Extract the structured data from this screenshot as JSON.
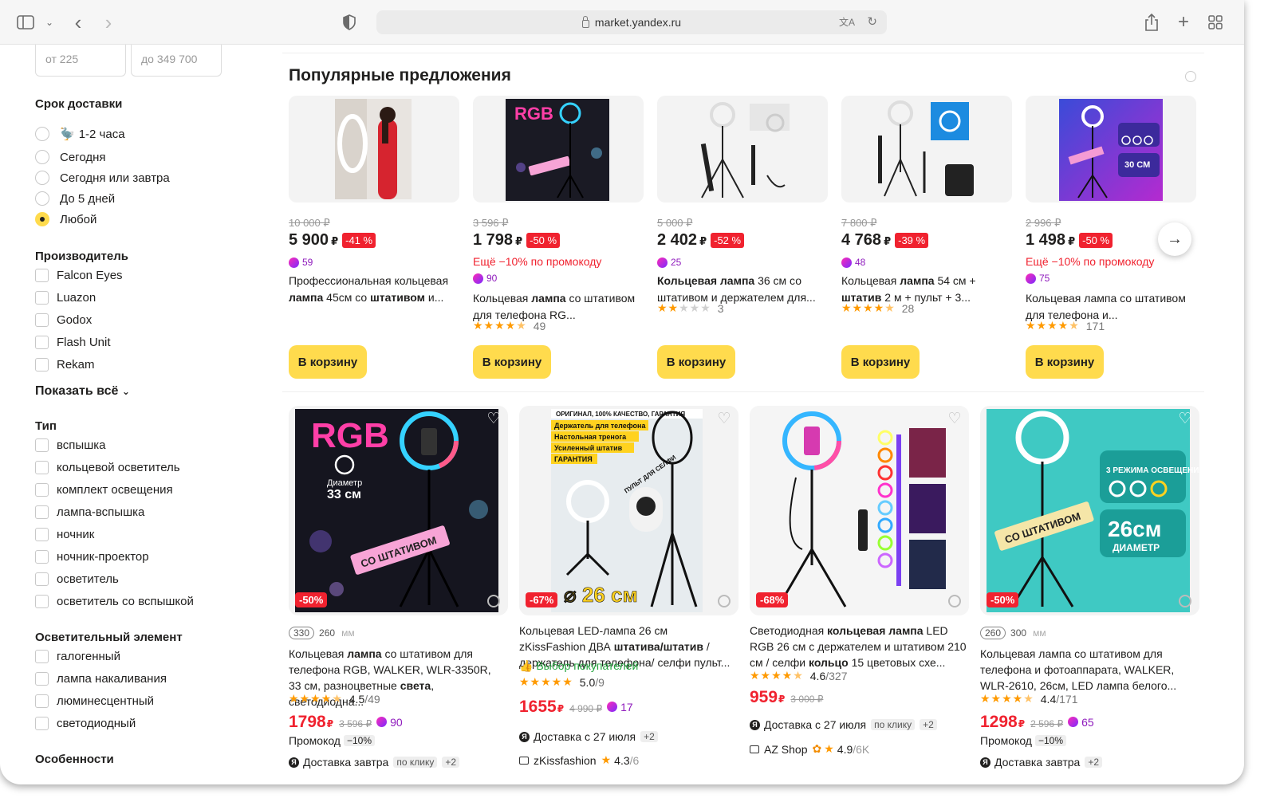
{
  "browser": {
    "url": "market.yandex.ru"
  },
  "sidebar": {
    "price_from": "от 225",
    "price_to": "до 349 700",
    "delivery": {
      "title": "Срок доставки",
      "options": [
        "1-2 часа",
        "Сегодня",
        "Сегодня или завтра",
        "До 5 дней",
        "Любой"
      ],
      "selected": "Любой"
    },
    "manufacturer": {
      "title": "Производитель",
      "options": [
        "Falcon Eyes",
        "Luazon",
        "Godox",
        "Flash Unit",
        "Rekam"
      ],
      "show_all": "Показать всё"
    },
    "type": {
      "title": "Тип",
      "options": [
        "вспышка",
        "кольцевой осветитель",
        "комплект освещения",
        "лампа-вспышка",
        "ночник",
        "ночник-проектор",
        "осветитель",
        "осветитель со вспышкой"
      ]
    },
    "light_element": {
      "title": "Осветительный элемент",
      "options": [
        "галогенный",
        "лампа накаливания",
        "люминесцентный",
        "светодиодный"
      ]
    },
    "features": {
      "title": "Особенности"
    }
  },
  "popular": {
    "title": "Популярные предложения",
    "cart_label": "В корзину",
    "cards": [
      {
        "old_price": "10 000 ₽",
        "price": "5 900",
        "rub": "₽",
        "discount": "-41 %",
        "promo": "",
        "cashback": "59",
        "title_html": "Профессиональная кольцевая <b>лампа</b> 45см со <b>штативом</b> и...",
        "rating": "",
        "stars": 0
      },
      {
        "old_price": "3 596 ₽",
        "price": "1 798",
        "rub": "₽",
        "discount": "-50 %",
        "promo": "Ещё −10% по промокоду",
        "cashback": "90",
        "title_html": "Кольцевая <b>лампа</b> со штативом для телефона RG...",
        "rating": "49",
        "stars": 4.5
      },
      {
        "old_price": "5 000 ₽",
        "price": "2 402",
        "rub": "₽",
        "discount": "-52 %",
        "promo": "",
        "cashback": "25",
        "title_html": "<b>Кольцевая лампа</b> 36 см со штативом и держателем для...",
        "rating": "3",
        "stars": 2
      },
      {
        "old_price": "7 800 ₽",
        "price": "4 768",
        "rub": "₽",
        "discount": "-39 %",
        "promo": "",
        "cashback": "48",
        "title_html": "Кольцевая <b>лампа</b> 54 см + <b>штатив</b> 2 м + пульт + 3...",
        "rating": "28",
        "stars": 4.5
      },
      {
        "old_price": "2 996 ₽",
        "price": "1 498",
        "rub": "₽",
        "discount": "-50 %",
        "promo": "Ещё −10% по промокоду",
        "cashback": "75",
        "title_html": "Кольцевая лампа со штативом для телефона и...",
        "rating": "171",
        "stars": 4.5
      }
    ]
  },
  "products": [
    {
      "sizes": [
        "330",
        "260"
      ],
      "size_unit": "мм",
      "discount": "-50%",
      "choice": "",
      "title_html": "Кольцевая <b>лампа</b> со штативом для телефона RGB, WALKER, WLR-3350R, 33 см, разноцветные <b>света</b>, светодиодна...",
      "rating": "4.5",
      "reviews": "/49",
      "price": "1798",
      "rub": "₽",
      "old_price": "3 596 ₽",
      "cashback": "90",
      "promo": "Промокод",
      "promo_val": "−10%",
      "delivery": "Доставка завтра",
      "delivery_tag": "по клику",
      "delivery_more": "+2",
      "shop": "",
      "shop_rating": "",
      "shop_reviews": ""
    },
    {
      "sizes": [],
      "size_unit": "",
      "discount": "-67%",
      "choice": "Выбор покупателей",
      "title_html": "Кольцевая LED-лампа 26 см zKissFashion ДВА <b>штатива/штатив</b> / держатель для телефона/ селфи пульт...",
      "rating": "5.0",
      "reviews": "/9",
      "price": "1655",
      "rub": "₽",
      "old_price": "4 990 ₽",
      "cashback": "17",
      "promo": "",
      "promo_val": "",
      "delivery": "Доставка с 27 июля",
      "delivery_tag": "",
      "delivery_more": "+2",
      "shop": "zKissfashion",
      "shop_rating": "4.3",
      "shop_reviews": "/6"
    },
    {
      "sizes": [],
      "size_unit": "",
      "discount": "-68%",
      "choice": "",
      "title_html": "Светодиодная <b>кольцевая лампа</b> LED RGB 26 см с держателем и штативом 210 см / селфи <b>кольцо</b> 15 цветовых схе...",
      "rating": "4.6",
      "reviews": "/327",
      "price": "959",
      "rub": "₽",
      "old_price": "3 000 ₽",
      "cashback": "",
      "promo": "",
      "promo_val": "",
      "delivery": "Доставка с 27 июля",
      "delivery_tag": "по клику",
      "delivery_more": "+2",
      "shop": "AZ Shop",
      "shop_rating": "4.9",
      "shop_reviews": "/6K"
    },
    {
      "sizes": [
        "260",
        "300"
      ],
      "size_unit": "мм",
      "discount": "-50%",
      "choice": "",
      "title_html": "Кольцевая лампа со штативом для телефона и фотоаппарата, WALKER, WLR-2610, 26см, LED лампа белого...",
      "rating": "4.4",
      "reviews": "/171",
      "price": "1298",
      "rub": "₽",
      "old_price": "2 596 ₽",
      "cashback": "65",
      "promo": "Промокод",
      "promo_val": "−10%",
      "delivery": "Доставка завтра",
      "delivery_tag": "",
      "delivery_more": "+2",
      "shop": "",
      "shop_rating": "",
      "shop_reviews": ""
    }
  ],
  "image_texts": {
    "rgb": "RGB",
    "diameter": "Диаметр",
    "cm33": "33 см",
    "cm26": "26 см",
    "tripod": "СО ШТАТИВОМ",
    "modes": "3 РЕЖИМА ОСВЕЩЕНИЯ",
    "diam26": "26см",
    "diam_label": "ДИАМЕТР",
    "cm30": "30 СМ",
    "zk_header": "ОРИГИНАЛ, 100% КАЧЕСТВО, ГАРАНТИЯ",
    "zk_l1": "Держатель для телефона",
    "zk_l2": "Настольная тренога",
    "zk_l3": "Усиленный штатив",
    "zk_l4": "ГАРАНТИЯ",
    "zk_remote": "ПУЛЬТ ДЛЯ СЕЛФИ",
    "zk_size": "⌀ 26 см"
  },
  "colors": {
    "accent_yellow": "#ffdb4d",
    "sale_red": "#f0222f",
    "plus_purple": "#8f1bbd",
    "star": "#ff9a00",
    "choice_green": "#22a33d"
  }
}
